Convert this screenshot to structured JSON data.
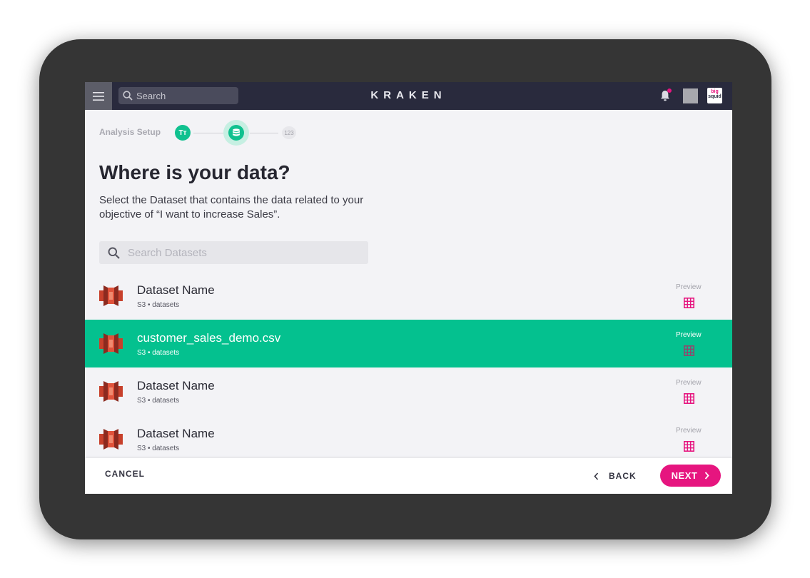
{
  "header": {
    "search_placeholder": "Search",
    "brand": "KRAKEN",
    "logo_top": "big",
    "logo_bottom": "squid"
  },
  "stepper": {
    "label": "Analysis Setup",
    "step1_glyph": "Tт",
    "step3_label": "123"
  },
  "main": {
    "title": "Where is your data?",
    "subtitle": "Select the Dataset that contains the data related to your objective of “I want to increase Sales”.",
    "search_placeholder": "Search Datasets"
  },
  "datasets": [
    {
      "name": "Dataset Name",
      "meta": "S3 • datasets",
      "preview": "Preview",
      "selected": false
    },
    {
      "name": "customer_sales_demo.csv",
      "meta": "S3 • datasets",
      "preview": "Preview",
      "selected": true
    },
    {
      "name": "Dataset Name",
      "meta": "S3 • datasets",
      "preview": "Preview",
      "selected": false
    },
    {
      "name": "Dataset Name",
      "meta": "S3 • datasets",
      "preview": "Preview",
      "selected": false
    }
  ],
  "footer": {
    "cancel": "CANCEL",
    "back": "BACK",
    "next": "NEXT"
  },
  "colors": {
    "accent": "#04c18f",
    "primary": "#e6157f",
    "topbar": "#292a3d"
  },
  "icons": {
    "menu": "hamburger-menu-icon",
    "search": "search-icon",
    "notifications": "bell-icon",
    "step2": "database-icon",
    "dataset": "aws-s3-bucket-icon",
    "preview": "grid-table-icon",
    "back": "chevron-left-icon",
    "next": "chevron-right-icon"
  }
}
